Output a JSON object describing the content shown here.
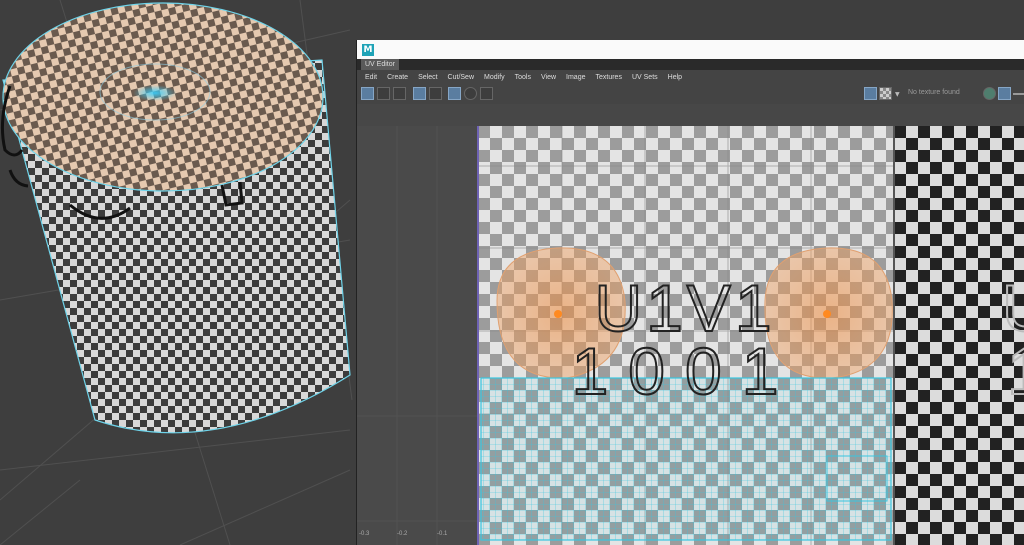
{
  "window": {
    "app_badge": "M",
    "tab_title": "UV Editor"
  },
  "menu": [
    "Edit",
    "Create",
    "Select",
    "Cut/Sew",
    "Modify",
    "Tools",
    "View",
    "Image",
    "Textures",
    "UV Sets",
    "Help"
  ],
  "toolbar": {
    "texture_status": "No texture found"
  },
  "uv_tile": {
    "name_line": "U1V1",
    "udim_line": "1001",
    "next_tile_name_partial": "U",
    "next_tile_udim_partial": "1"
  },
  "axis": {
    "ticks": [
      "-0.3",
      "-0.2",
      "-0.1"
    ]
  },
  "colors": {
    "uv_shell_border": "#39c6e0",
    "uv_shell_fill": "#f0a060",
    "toolbar_active": "#5a7da0",
    "viewport_bg": "#3e3e3e"
  }
}
